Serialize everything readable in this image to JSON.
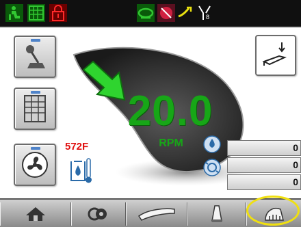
{
  "status_bar": {
    "icons": [
      "seat-operator-icon",
      "keypad-check-icon",
      "lock-alert-icon",
      "speed-mode-icon",
      "no-horn-icon",
      "hydraulic-flow-icon",
      "auxiliary-valve-icon"
    ]
  },
  "side_buttons": [
    "joystick-control-icon",
    "keypad-icon",
    "fan-icon"
  ],
  "gauge": {
    "value": "20.0",
    "unit": "RPM"
  },
  "temperature": {
    "value": "572F"
  },
  "readouts": [
    {
      "value": "0"
    },
    {
      "value": "0"
    },
    {
      "value": "0"
    }
  ],
  "bottom_nav": [
    "home-icon",
    "attachment-coupler-icon",
    "blade-icon",
    "cone-tool-icon",
    "drum-tool-icon"
  ],
  "colors": {
    "rpm_green": "#17a617",
    "temp_red": "#e01010",
    "highlight": "#f0e010",
    "topbar": "#101010"
  }
}
